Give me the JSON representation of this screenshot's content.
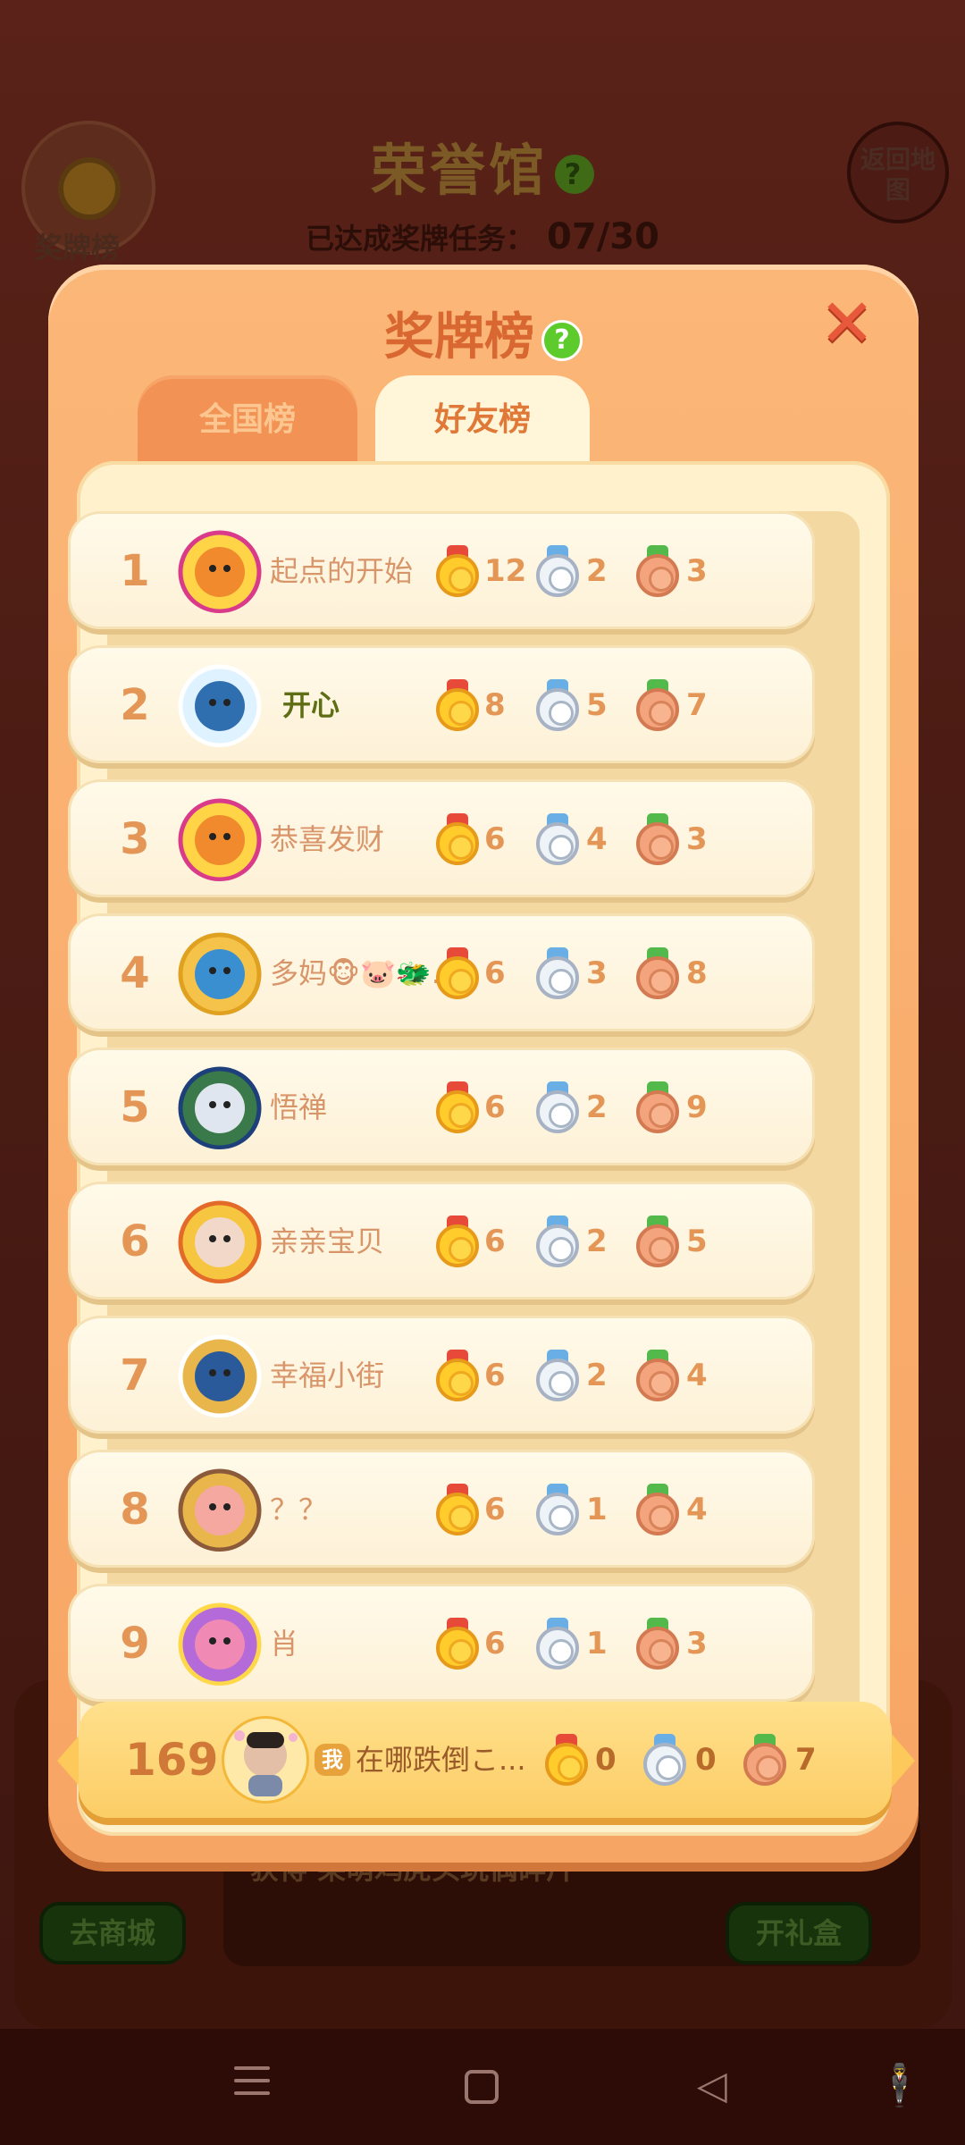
{
  "background": {
    "title": "荣誉馆",
    "progress_label": "已达成奖牌任务：",
    "progress_value": "07/30",
    "medal_button_label": "奖牌榜",
    "back_button_label": "返回地图",
    "prize_text": "获得 莱萌鸡虎头玩偶碎片",
    "shop_button": "去商城",
    "gift_button": "开礼盒"
  },
  "modal": {
    "title": "奖牌榜",
    "help": "?",
    "close": "✕",
    "tabs": [
      {
        "label": "全国榜",
        "active": false
      },
      {
        "label": "好友榜",
        "active": true
      }
    ]
  },
  "leaderboard": [
    {
      "rank": "1",
      "name": "起点的开始",
      "gold": "12",
      "silver": "2",
      "bronze": "3",
      "avatar": "chick-4000-frame-avatar"
    },
    {
      "rank": "2",
      "name": "开心",
      "gold": "8",
      "silver": "5",
      "bronze": "7",
      "avatar": "cloud-bird-avatar",
      "highlight": true
    },
    {
      "rank": "3",
      "name": "恭喜发财",
      "gold": "6",
      "silver": "4",
      "bronze": "3",
      "avatar": "chick-4000-frame-avatar"
    },
    {
      "rank": "4",
      "name": "多妈🐵🐷🐲...",
      "gold": "6",
      "silver": "3",
      "bronze": "8",
      "avatar": "ox-avatar"
    },
    {
      "rank": "5",
      "name": "悟禅",
      "gold": "6",
      "silver": "2",
      "bronze": "9",
      "avatar": "statue-photo-avatar"
    },
    {
      "rank": "6",
      "name": "亲亲宝贝",
      "gold": "6",
      "silver": "2",
      "bronze": "5",
      "avatar": "baby-photo-avatar"
    },
    {
      "rank": "7",
      "name": "幸福小街",
      "gold": "6",
      "silver": "2",
      "bronze": "4",
      "avatar": "penguin-avatar"
    },
    {
      "rank": "8",
      "name": "？？",
      "gold": "6",
      "silver": "1",
      "bronze": "4",
      "avatar": "pig-avatar"
    },
    {
      "rank": "9",
      "name": "肖",
      "gold": "6",
      "silver": "1",
      "bronze": "3",
      "avatar": "pink-octopus-avatar"
    }
  ],
  "my_entry": {
    "rank": "169",
    "me_tag": "我",
    "name": "在哪跌倒こ...",
    "gold": "0",
    "silver": "0",
    "bronze": "7"
  },
  "colors": {
    "modal_bg": "#f7a564",
    "panel_bg": "#fff1cc",
    "rank_text": "#e49656",
    "highlight_name": "#5e6e14",
    "my_row_bg": "#fccd66"
  }
}
